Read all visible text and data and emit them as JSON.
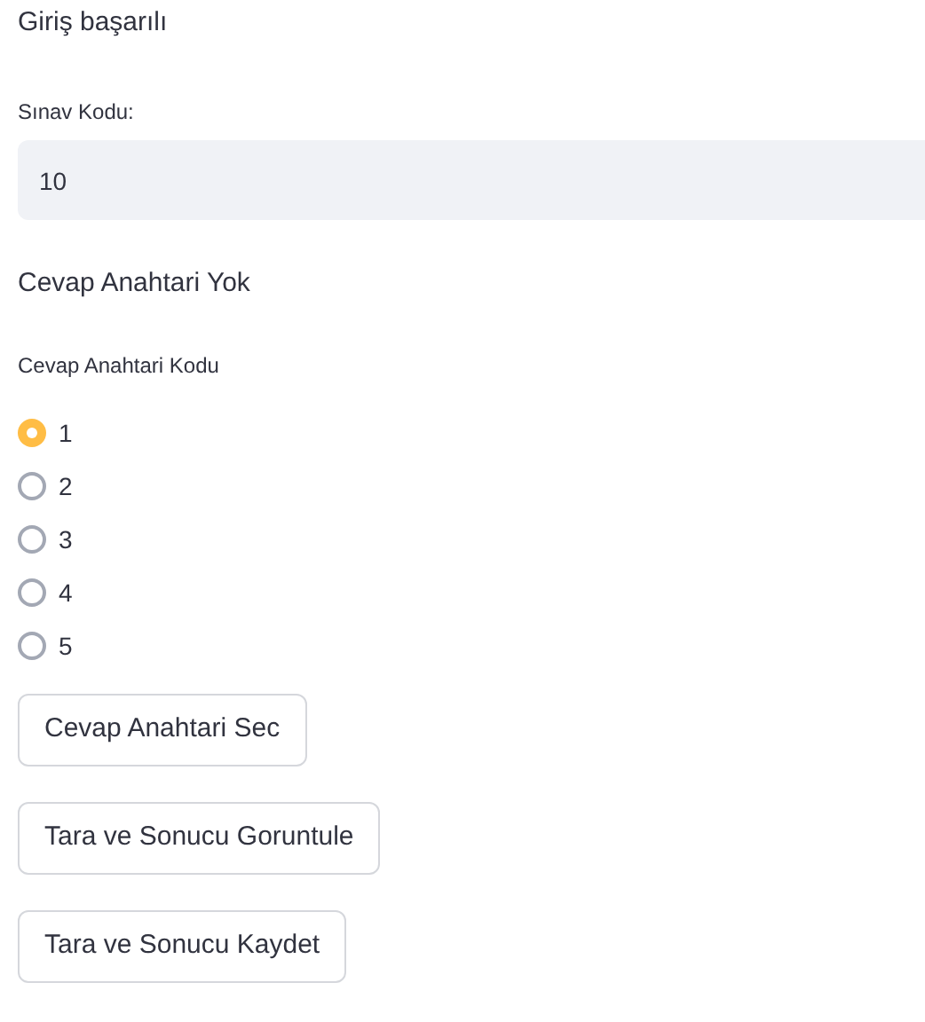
{
  "message": "Giriş başarılı",
  "exam_code": {
    "label": "Sınav Kodu:",
    "value": "10"
  },
  "status": "Cevap Anahtari Yok",
  "answer_key": {
    "label": "Cevap Anahtari Kodu",
    "options": [
      {
        "label": "1",
        "selected": true
      },
      {
        "label": "2",
        "selected": false
      },
      {
        "label": "3",
        "selected": false
      },
      {
        "label": "4",
        "selected": false
      },
      {
        "label": "5",
        "selected": false
      }
    ]
  },
  "buttons": [
    "Cevap Anahtari Sec",
    "Tara ve Sonucu Goruntule",
    "Tara ve Sonucu Kaydet"
  ]
}
